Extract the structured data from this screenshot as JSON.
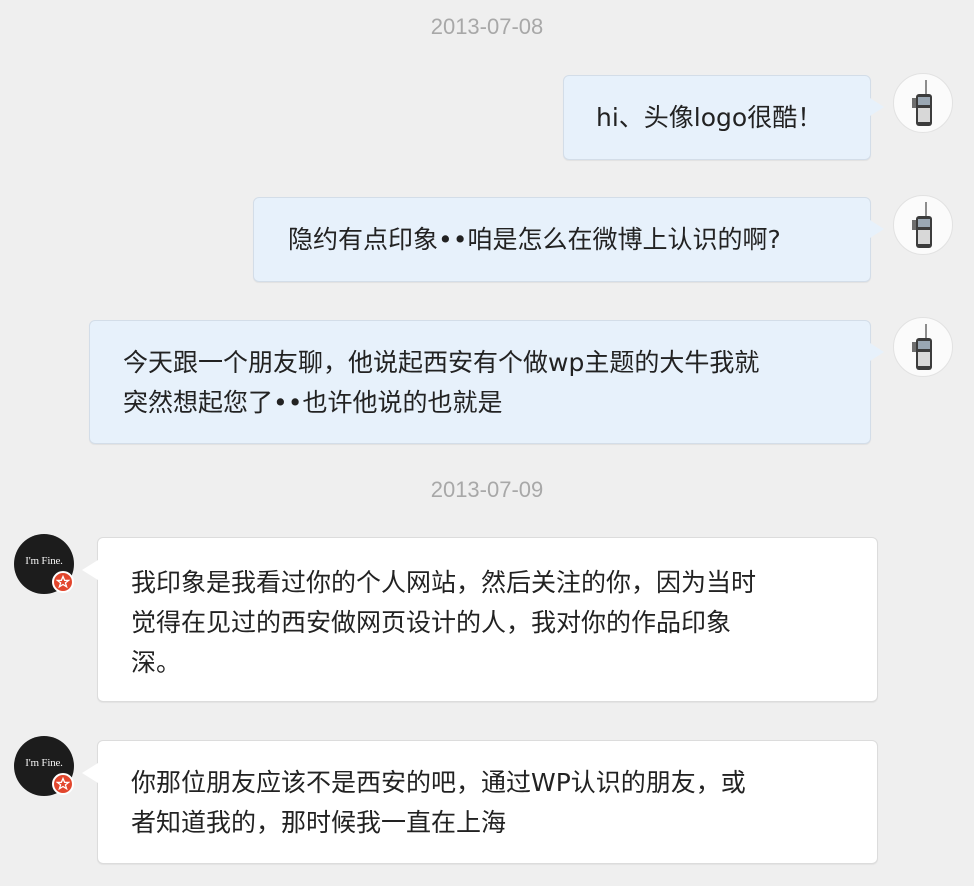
{
  "avatars": {
    "self_icon": "walkie-talkie-icon",
    "other_text": "I'm Fine.",
    "other_badge_icon": "verified-badge-icon"
  },
  "colors": {
    "background": "#efefef",
    "outgoing_bubble": "#e7f1fb",
    "incoming_bubble": "#ffffff",
    "timestamp": "#a8a8a8",
    "badge": "#e2462d"
  },
  "conversation": [
    {
      "type": "timestamp",
      "text": "2013-07-08"
    },
    {
      "type": "message",
      "direction": "outgoing",
      "text": "hi、头像logo很酷！"
    },
    {
      "type": "message",
      "direction": "outgoing",
      "text": "隐约有点印象••咱是怎么在微博上认识的啊?"
    },
    {
      "type": "message",
      "direction": "outgoing",
      "text": "今天跟一个朋友聊，他说起西安有个做wp主题的大牛我就\n突然想起您了••也许他说的也就是"
    },
    {
      "type": "timestamp",
      "text": "2013-07-09"
    },
    {
      "type": "message",
      "direction": "incoming",
      "text": "我印象是我看过你的个人网站，然后关注的你，因为当时\n觉得在见过的西安做网页设计的人，我对你的作品印象\n深。"
    },
    {
      "type": "message",
      "direction": "incoming",
      "text": "你那位朋友应该不是西安的吧，通过WP认识的朋友，或\n者知道我的，那时候我一直在上海"
    }
  ]
}
